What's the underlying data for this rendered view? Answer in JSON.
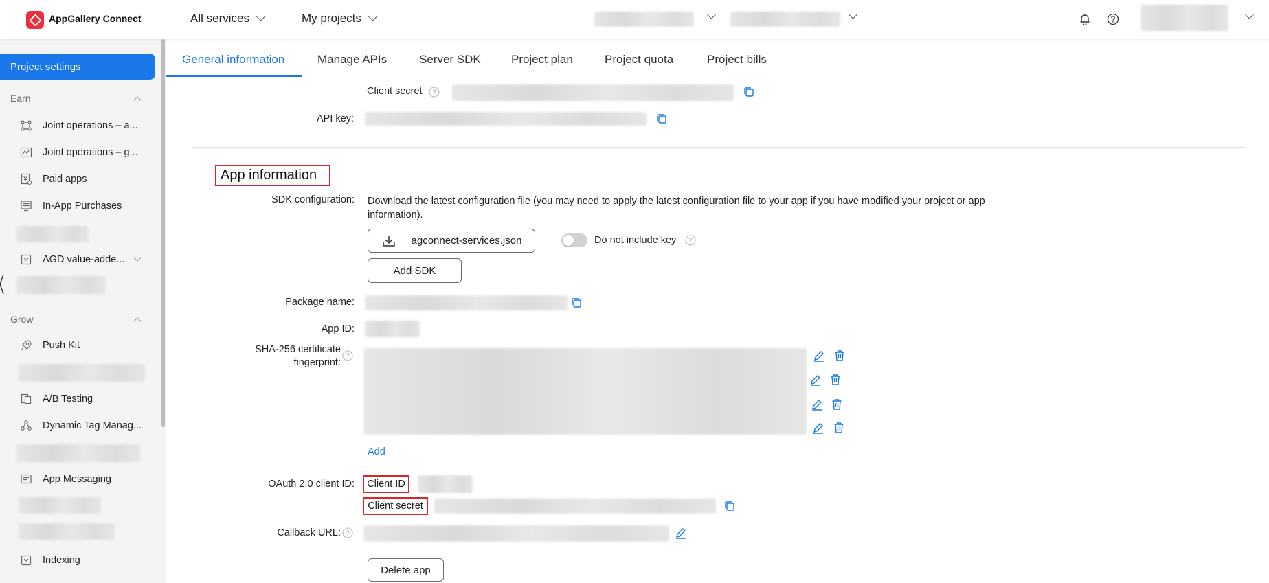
{
  "header": {
    "logo_text": "AppGallery Connect",
    "menus": [
      {
        "label": "All services"
      },
      {
        "label": "My projects"
      }
    ],
    "icons": [
      "bell-icon",
      "help-icon"
    ]
  },
  "sidebar": {
    "active_item": "Project settings",
    "groups": [
      {
        "label": "Earn",
        "items": [
          "Joint operations – a...",
          "Joint operations – g...",
          "Paid apps",
          "In-App Purchases",
          "AGD value-adde..."
        ]
      },
      {
        "label": "Grow",
        "items": [
          "Push Kit",
          "A/B Testing",
          "Dynamic Tag Manag...",
          "App Messaging",
          "Indexing"
        ]
      }
    ]
  },
  "tabs": [
    {
      "label": "General information",
      "active": true
    },
    {
      "label": "Manage APIs"
    },
    {
      "label": "Server SDK"
    },
    {
      "label": "Project plan"
    },
    {
      "label": "Project quota"
    },
    {
      "label": "Project bills"
    }
  ],
  "project_section": {
    "client_secret_label": "Client secret",
    "api_key_label": "API key:"
  },
  "app_section": {
    "title": "App information",
    "sdk_label": "SDK configuration:",
    "sdk_description": "Download the latest configuration file (you may need to apply the latest configuration file to your app if you have modified your project or app information).",
    "download_button": "agconnect-services.json",
    "toggle_label": "Do not include key",
    "add_sdk_button": "Add SDK",
    "package_name_label": "Package name:",
    "app_id_label": "App ID:",
    "sha_label_line1": "SHA-256 certificate",
    "sha_label_line2": "fingerprint:",
    "add_link": "Add",
    "oauth_label": "OAuth 2.0 client ID:",
    "client_id_label": "Client ID",
    "client_secret_label": "Client secret",
    "callback_label": "Callback URL:",
    "delete_button": "Delete app"
  },
  "colors": {
    "accent": "#1a78ea",
    "highlight_box": "#d9262b",
    "brand": "#e8303f"
  }
}
